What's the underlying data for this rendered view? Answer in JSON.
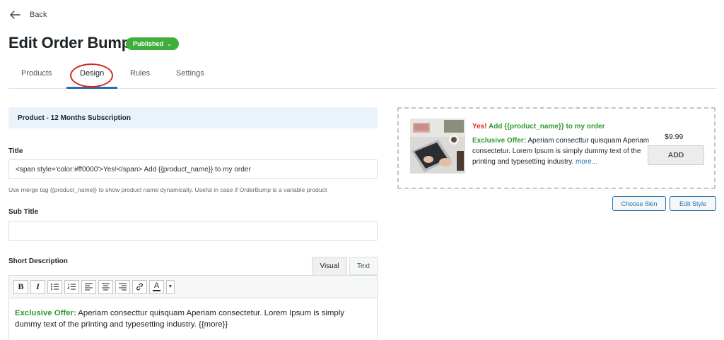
{
  "nav": {
    "back_label": "Back"
  },
  "header": {
    "title": "Edit Order Bump",
    "status": "Published"
  },
  "tabs": [
    {
      "label": "Products"
    },
    {
      "label": "Design"
    },
    {
      "label": "Rules"
    },
    {
      "label": "Settings"
    }
  ],
  "active_tab": "Design",
  "highlight_color": "#d7261e",
  "panel": {
    "title": "Product - 12 Months Subscription"
  },
  "form": {
    "title_label": "Title",
    "title_value": "<span style='color:#ff0000'>Yes!</span> Add {{product_name}} to my order",
    "title_help": "Use merge tag {{product_name}} to show product name dynamically. Useful in case if OrderBump is a variable product",
    "subtitle_label": "Sub Title",
    "subtitle_value": "",
    "short_desc_label": "Short Description"
  },
  "editor": {
    "tabs": [
      "Visual",
      "Text"
    ],
    "toolbar": [
      {
        "icon": "bold-icon"
      },
      {
        "icon": "italic-icon"
      },
      {
        "icon": "bullet-list-icon"
      },
      {
        "icon": "numbered-list-icon"
      },
      {
        "icon": "align-left-icon"
      },
      {
        "icon": "align-center-icon"
      },
      {
        "icon": "align-right-icon"
      },
      {
        "icon": "link-icon"
      },
      {
        "icon": "text-color-icon"
      }
    ],
    "content_offer": "Exclusive Offer:",
    "content_text": " Aperiam consecttur quisquam Aperiam consectetur. Lorem Ipsum is simply dummy text of the printing and typesetting industry. {{more}}"
  },
  "preview": {
    "heading_yes": "Yes!",
    "heading_rest": " Add {{product_name}} to my order",
    "offer_label": "Exclusive Offer:",
    "description": " Aperiam consecttur quisquam Aperiam consectetur. Lorem Ipsum is simply dummy text of the printing and typesetting industry.",
    "more_link": "more...",
    "price": "$9.99",
    "add_label": "ADD"
  },
  "actions": {
    "choose_skin": "Choose Skin",
    "edit_style": "Edit Style"
  },
  "colors": {
    "accent": "#2271b1",
    "badge": "#3fae3a",
    "offer_green": "#2e9a2e",
    "yes_red": "#e02424"
  }
}
